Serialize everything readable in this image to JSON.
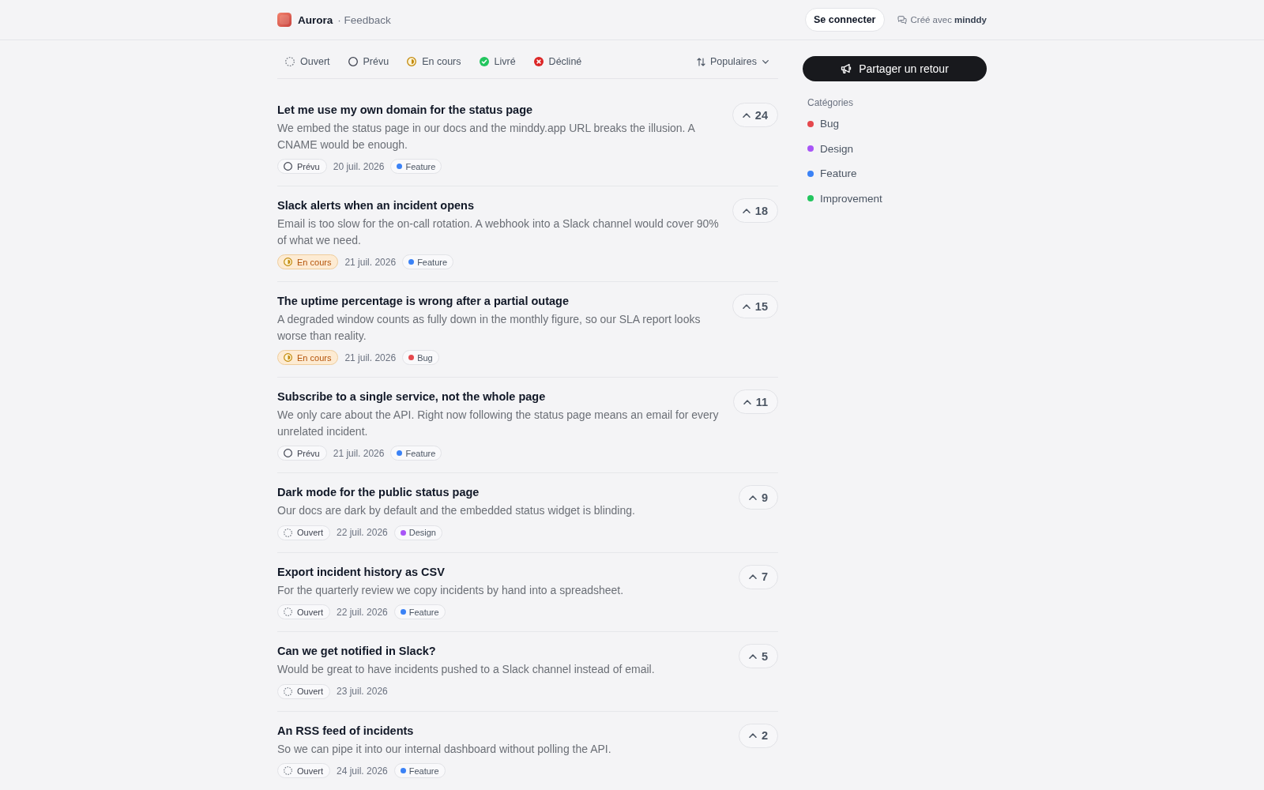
{
  "header": {
    "brand": "Aurora",
    "section": "· Feedback",
    "login_button": "Se connecter",
    "credit": "Créé avec **minddy**"
  },
  "filters": [
    {
      "label": "Ouvert",
      "kind": "open",
      "selected": false
    },
    {
      "label": "Prévu",
      "kind": "planned",
      "selected": false
    },
    {
      "label": "En cours",
      "kind": "in_progress",
      "selected": false
    },
    {
      "label": "Livré",
      "kind": "done",
      "selected": false
    },
    {
      "label": "Décliné",
      "kind": "declined",
      "selected": false
    }
  ],
  "sort": {
    "label": "Populaires"
  },
  "posts": [
    {
      "title": "Let me use my own domain for the status page",
      "description": "We embed the status page in our docs and the minddy.app URL breaks the illusion. A CNAME would be enough.",
      "status": {
        "label": "Prévu",
        "kind": "planned"
      },
      "date": "20 juil. 2026",
      "category": {
        "name": "Feature",
        "color": "#3b82f6"
      },
      "votes": "24"
    },
    {
      "title": "Slack alerts when an incident opens",
      "description": "Email is too slow for the on-call rotation. A webhook into a Slack channel would cover 90% of what we need.",
      "status": {
        "label": "En cours",
        "kind": "in_progress"
      },
      "date": "21 juil. 2026",
      "category": {
        "name": "Feature",
        "color": "#3b82f6"
      },
      "votes": "18"
    },
    {
      "title": "The uptime percentage is wrong after a partial outage",
      "description": "A degraded window counts as fully down in the monthly figure, so our SLA report looks worse than reality.",
      "status": {
        "label": "En cours",
        "kind": "in_progress"
      },
      "date": "21 juil. 2026",
      "category": {
        "name": "Bug",
        "color": "#e5484d"
      },
      "votes": "15"
    },
    {
      "title": "Subscribe to a single service, not the whole page",
      "description": "We only care about the API. Right now following the status page means an email for every unrelated incident.",
      "status": {
        "label": "Prévu",
        "kind": "planned"
      },
      "date": "21 juil. 2026",
      "category": {
        "name": "Feature",
        "color": "#3b82f6"
      },
      "votes": "11"
    },
    {
      "title": "Dark mode for the public status page",
      "description": "Our docs are dark by default and the embedded status widget is blinding.",
      "status": {
        "label": "Ouvert",
        "kind": "open"
      },
      "date": "22 juil. 2026",
      "category": {
        "name": "Design",
        "color": "#a855f7"
      },
      "votes": "9"
    },
    {
      "title": "Export incident history as CSV",
      "description": "For the quarterly review we copy incidents by hand into a spreadsheet.",
      "status": {
        "label": "Ouvert",
        "kind": "open"
      },
      "date": "22 juil. 2026",
      "category": {
        "name": "Feature",
        "color": "#3b82f6"
      },
      "votes": "7"
    },
    {
      "title": "Can we get notified in Slack?",
      "description": "Would be great to have incidents pushed to a Slack channel instead of email.",
      "status": {
        "label": "Ouvert",
        "kind": "open"
      },
      "date": "23 juil. 2026",
      "votes": "5"
    },
    {
      "title": "An RSS feed of incidents",
      "description": "So we can pipe it into our internal dashboard without polling the API.",
      "status": {
        "label": "Ouvert",
        "kind": "open"
      },
      "date": "24 juil. 2026",
      "category": {
        "name": "Feature",
        "color": "#3b82f6"
      },
      "votes": "2"
    }
  ],
  "sidebar": {
    "share_button": "Partager un retour",
    "categories_title": "Catégories",
    "categories": [
      {
        "name": "Bug",
        "color": "#e5484d"
      },
      {
        "name": "Design",
        "color": "#a855f7"
      },
      {
        "name": "Feature",
        "color": "#3b82f6"
      },
      {
        "name": "Improvement",
        "color": "#22c55e"
      }
    ]
  }
}
